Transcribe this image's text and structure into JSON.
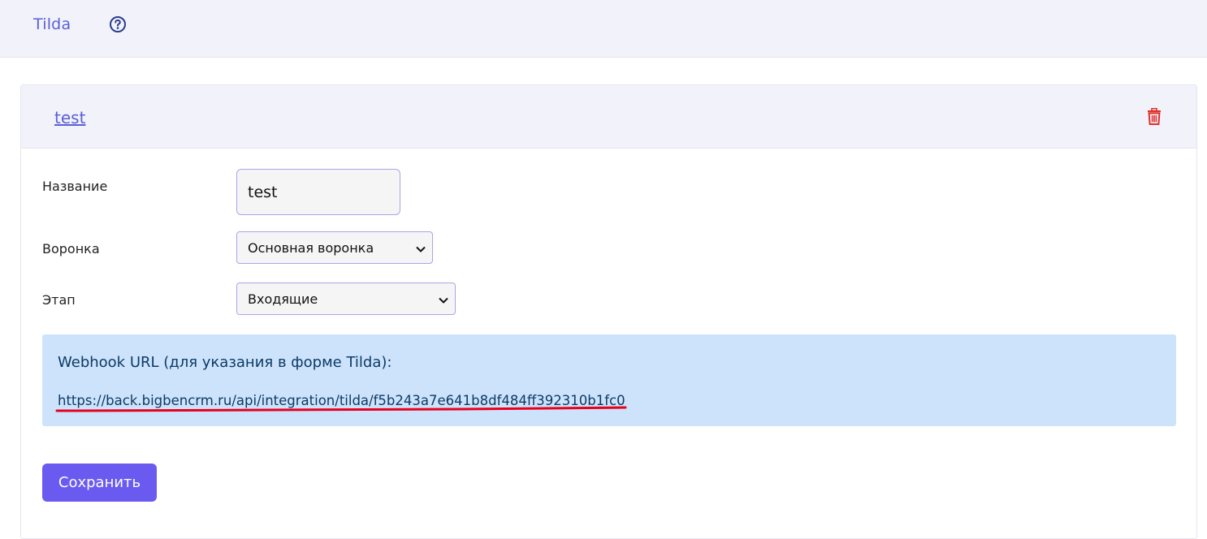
{
  "topbar": {
    "title": "Tilda",
    "help_icon": "question-circle-icon"
  },
  "integration": {
    "name_link": "test",
    "delete_icon": "trash-icon",
    "form": {
      "name_label": "Название",
      "name_value": "test",
      "funnel_label": "Воронка",
      "funnel_value": "Основная воронка",
      "stage_label": "Этап",
      "stage_value": "Входящие"
    },
    "webhook": {
      "heading": "Webhook URL (для указания в форме Tilda):",
      "url": "https://back.bigbencrm.ru/api/integration/tilda/f5b243a7e641b8df484ff392310b1fc0"
    },
    "save_label": "Сохранить"
  },
  "colors": {
    "accent": "#5a5fd6",
    "button": "#6a5af0",
    "info_bg": "#cce3fb",
    "danger": "#e0312b",
    "annotation_red": "#e8001c"
  }
}
